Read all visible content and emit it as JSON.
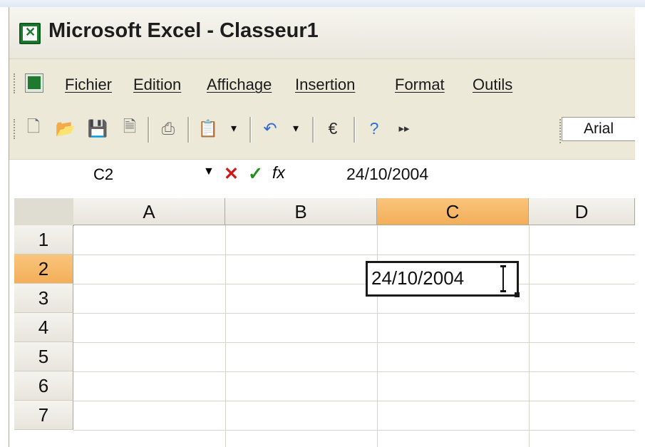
{
  "window": {
    "title": "Microsoft Excel - Classeur1"
  },
  "menu": {
    "items": [
      "Fichier",
      "Edition",
      "Affichage",
      "Insertion",
      "Format",
      "Outils"
    ]
  },
  "toolbar": {
    "buttons": [
      "new-file-icon",
      "open-folder-icon",
      "save-icon",
      "print-preview-icon",
      "print-icon",
      "paste-icon",
      "undo-icon",
      "euro-icon",
      "help-icon",
      "toolbar-options-icon"
    ],
    "font_name": "Arial"
  },
  "formula_bar": {
    "name_box": "C2",
    "formula": "24/10/2004",
    "cancel_icon": "cancel-icon",
    "enter_icon": "enter-icon",
    "fx_label": "fx"
  },
  "sheet": {
    "columns": [
      "A",
      "B",
      "C",
      "D"
    ],
    "rows": [
      "1",
      "2",
      "3",
      "4",
      "5",
      "6",
      "7"
    ],
    "active_column": "C",
    "active_row": "2",
    "cells": {
      "C2": "24/10/2004"
    }
  },
  "colors": {
    "active_header": "#f3ae59",
    "cancel": "#cc1a1a",
    "enter": "#1f8f1f",
    "excel_green": "#1f7a2f"
  }
}
